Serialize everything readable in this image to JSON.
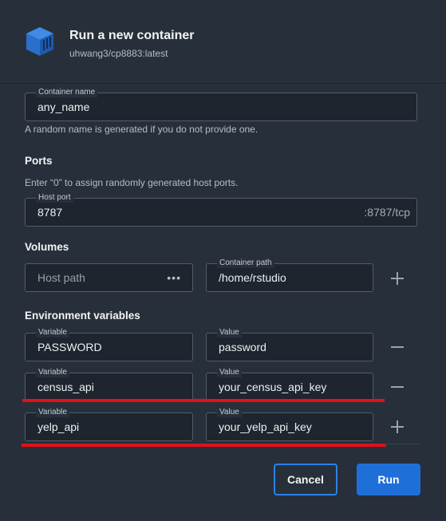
{
  "header": {
    "title": "Run a new container",
    "image": "uhwang3/cp8883:latest",
    "icon": "container-cube-icon"
  },
  "container_name": {
    "label": "Container name",
    "value": "any_name",
    "helper": "A random name is generated if you do not provide one."
  },
  "ports": {
    "heading": "Ports",
    "helper": "Enter “0” to assign randomly generated host ports.",
    "host_port_label": "Host port",
    "host_port_value": "8787",
    "container_port": ":8787/tcp"
  },
  "volumes": {
    "heading": "Volumes",
    "host_path_placeholder": "Host path",
    "browse_dots": "•••",
    "container_path_label": "Container path",
    "container_path_value": "/home/rstudio"
  },
  "env": {
    "heading": "Environment variables",
    "rows": [
      {
        "var_label": "Variable",
        "var_value": "PASSWORD",
        "val_label": "Value",
        "val_value": "password",
        "action": "minus"
      },
      {
        "var_label": "Variable",
        "var_value": "census_api",
        "val_label": "Value",
        "val_value": "your_census_api_key",
        "action": "minus"
      },
      {
        "var_label": "Variable",
        "var_value": "yelp_api",
        "val_label": "Value",
        "val_value": "your_yelp_api_key",
        "action": "plus"
      }
    ]
  },
  "buttons": {
    "cancel": "Cancel",
    "run": "Run"
  },
  "colors": {
    "accent": "#1f6fd9",
    "annotation_red": "#e3101a",
    "background": "#27303a",
    "field_bg": "#1e252e"
  }
}
